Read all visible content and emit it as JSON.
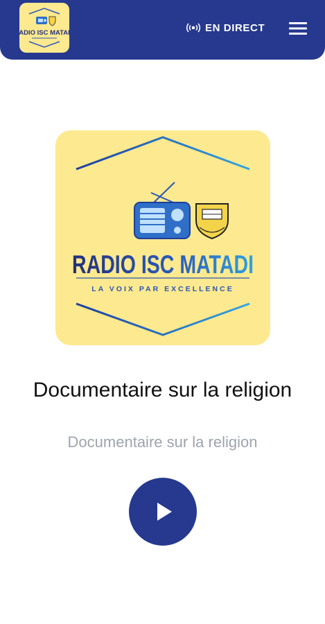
{
  "header": {
    "logo_text": "RADIO ISC MATADI",
    "live_label": "EN DIRECT",
    "live_icon": "broadcast-icon",
    "menu_icon": "hamburger-menu-icon"
  },
  "cover": {
    "station_name": "RADIO ISC MATADI",
    "tagline": "LA VOIX PAR EXCELLENCE"
  },
  "now_playing": {
    "title": "Documentaire sur la religion",
    "subtitle": "Documentaire sur la religion"
  },
  "controls": {
    "play_icon": "play-icon"
  },
  "colors": {
    "brand_blue": "#26398f",
    "logo_background": "#fde98f",
    "subtitle_gray": "#9ea3ad"
  }
}
